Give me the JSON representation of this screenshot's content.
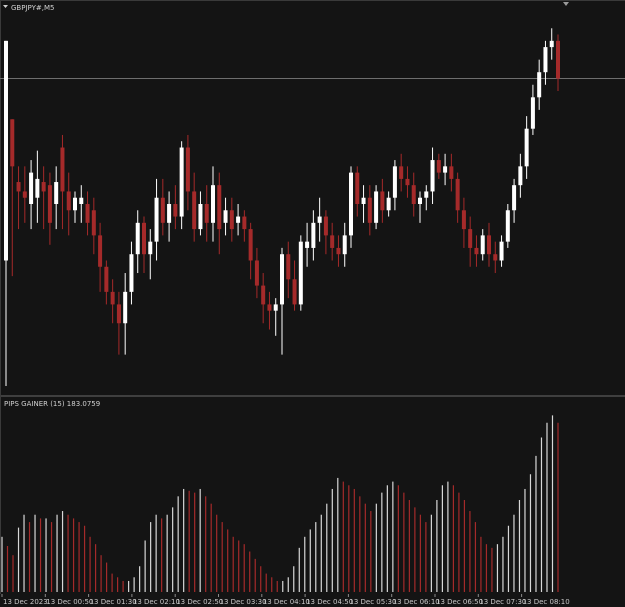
{
  "chart": {
    "symbol_label": "GBPJPY#,M5",
    "indicator_label": "PIPS GAINER (15) 183.0759",
    "colors": {
      "background": "#141414",
      "bull": "#ffffff",
      "bear": "#a52a2a",
      "grid_line": "#5a5a5a",
      "text": "#c8c8c8"
    }
  },
  "chart_data": [
    {
      "type": "candlestick",
      "title": "GBPJPY#,M5",
      "candles": [
        {
          "o": 184.2,
          "h": 183.9,
          "c": 183.5,
          "l": 183.1,
          "dir": "bull"
        },
        {
          "o": 183.95,
          "h": 183.9,
          "c": 183.8,
          "l": 183.45,
          "dir": "bear"
        },
        {
          "o": 183.72,
          "h": 183.8,
          "c": 183.75,
          "l": 183.6,
          "dir": "bear"
        },
        {
          "o": 183.7,
          "h": 183.8,
          "c": 183.72,
          "l": 183.62,
          "dir": "bear"
        },
        {
          "o": 183.68,
          "h": 183.82,
          "c": 183.78,
          "l": 183.6,
          "dir": "bull"
        },
        {
          "o": 183.76,
          "h": 183.85,
          "c": 183.7,
          "l": 183.62,
          "dir": "bull"
        },
        {
          "o": 183.72,
          "h": 183.8,
          "c": 183.75,
          "l": 183.6,
          "dir": "bear"
        },
        {
          "o": 183.74,
          "h": 183.78,
          "c": 183.62,
          "l": 183.55,
          "dir": "bear"
        },
        {
          "o": 183.68,
          "h": 183.8,
          "c": 183.75,
          "l": 183.6,
          "dir": "bull"
        },
        {
          "o": 183.86,
          "h": 183.9,
          "c": 183.72,
          "l": 183.6,
          "dir": "bear"
        },
        {
          "o": 183.72,
          "h": 183.78,
          "c": 183.66,
          "l": 183.58,
          "dir": "bear"
        },
        {
          "o": 183.66,
          "h": 183.72,
          "c": 183.7,
          "l": 183.62,
          "dir": "bull"
        },
        {
          "o": 183.7,
          "h": 183.74,
          "c": 183.68,
          "l": 183.62,
          "dir": "bull"
        },
        {
          "o": 183.68,
          "h": 183.72,
          "c": 183.62,
          "l": 183.58,
          "dir": "bear"
        },
        {
          "o": 183.66,
          "h": 183.7,
          "c": 183.58,
          "l": 183.52,
          "dir": "bear"
        },
        {
          "o": 183.58,
          "h": 183.62,
          "c": 183.48,
          "l": 183.4,
          "dir": "bear"
        },
        {
          "o": 183.48,
          "h": 183.5,
          "c": 183.4,
          "l": 183.36,
          "dir": "bear"
        },
        {
          "o": 183.4,
          "h": 183.44,
          "c": 183.36,
          "l": 183.3,
          "dir": "bear"
        },
        {
          "o": 183.36,
          "h": 183.4,
          "c": 183.3,
          "l": 183.2,
          "dir": "bear"
        },
        {
          "o": 183.3,
          "h": 183.46,
          "c": 183.4,
          "l": 183.2,
          "dir": "bull"
        },
        {
          "o": 183.4,
          "h": 183.56,
          "c": 183.52,
          "l": 183.36,
          "dir": "bull"
        },
        {
          "o": 183.52,
          "h": 183.66,
          "c": 183.62,
          "l": 183.46,
          "dir": "bull"
        },
        {
          "o": 183.62,
          "h": 183.64,
          "c": 183.52,
          "l": 183.46,
          "dir": "bear"
        },
        {
          "o": 183.52,
          "h": 183.6,
          "c": 183.56,
          "l": 183.44,
          "dir": "bull"
        },
        {
          "o": 183.56,
          "h": 183.76,
          "c": 183.7,
          "l": 183.5,
          "dir": "bull"
        },
        {
          "o": 183.7,
          "h": 183.76,
          "c": 183.62,
          "l": 183.58,
          "dir": "bear"
        },
        {
          "o": 183.62,
          "h": 183.72,
          "c": 183.68,
          "l": 183.56,
          "dir": "bull"
        },
        {
          "o": 183.68,
          "h": 183.74,
          "c": 183.64,
          "l": 183.6,
          "dir": "bear"
        },
        {
          "o": 183.64,
          "h": 183.88,
          "c": 183.86,
          "l": 183.6,
          "dir": "bull"
        },
        {
          "o": 183.86,
          "h": 183.9,
          "c": 183.72,
          "l": 183.66,
          "dir": "bear"
        },
        {
          "o": 183.72,
          "h": 183.78,
          "c": 183.6,
          "l": 183.56,
          "dir": "bear"
        },
        {
          "o": 183.6,
          "h": 183.72,
          "c": 183.68,
          "l": 183.58,
          "dir": "bull"
        },
        {
          "o": 183.68,
          "h": 183.74,
          "c": 183.62,
          "l": 183.56,
          "dir": "bear"
        },
        {
          "o": 183.62,
          "h": 183.8,
          "c": 183.74,
          "l": 183.56,
          "dir": "bull"
        },
        {
          "o": 183.74,
          "h": 183.78,
          "c": 183.6,
          "l": 183.52,
          "dir": "bear"
        },
        {
          "o": 183.62,
          "h": 183.7,
          "c": 183.66,
          "l": 183.58,
          "dir": "bull"
        },
        {
          "o": 183.66,
          "h": 183.7,
          "c": 183.6,
          "l": 183.56,
          "dir": "bear"
        },
        {
          "o": 183.62,
          "h": 183.68,
          "c": 183.64,
          "l": 183.58,
          "dir": "bull"
        },
        {
          "o": 183.64,
          "h": 183.66,
          "c": 183.6,
          "l": 183.56,
          "dir": "bear"
        },
        {
          "o": 183.6,
          "h": 183.62,
          "c": 183.5,
          "l": 183.44,
          "dir": "bear"
        },
        {
          "o": 183.5,
          "h": 183.54,
          "c": 183.42,
          "l": 183.38,
          "dir": "bear"
        },
        {
          "o": 183.42,
          "h": 183.46,
          "c": 183.36,
          "l": 183.3,
          "dir": "bear"
        },
        {
          "o": 183.36,
          "h": 183.4,
          "c": 183.34,
          "l": 183.28,
          "dir": "bear"
        },
        {
          "o": 183.34,
          "h": 183.38,
          "c": 183.36,
          "l": 183.26,
          "dir": "bull"
        },
        {
          "o": 183.36,
          "h": 183.54,
          "c": 183.52,
          "l": 183.2,
          "dir": "bull"
        },
        {
          "o": 183.52,
          "h": 183.56,
          "c": 183.44,
          "l": 183.38,
          "dir": "bear"
        },
        {
          "o": 183.44,
          "h": 183.5,
          "c": 183.36,
          "l": 183.34,
          "dir": "bear"
        },
        {
          "o": 183.36,
          "h": 183.58,
          "c": 183.56,
          "l": 183.34,
          "dir": "bull"
        },
        {
          "o": 183.56,
          "h": 183.62,
          "c": 183.54,
          "l": 183.48,
          "dir": "bull"
        },
        {
          "o": 183.54,
          "h": 183.66,
          "c": 183.62,
          "l": 183.5,
          "dir": "bull"
        },
        {
          "o": 183.62,
          "h": 183.7,
          "c": 183.64,
          "l": 183.56,
          "dir": "bull"
        },
        {
          "o": 183.64,
          "h": 183.66,
          "c": 183.58,
          "l": 183.52,
          "dir": "bear"
        },
        {
          "o": 183.58,
          "h": 183.62,
          "c": 183.54,
          "l": 183.5,
          "dir": "bear"
        },
        {
          "o": 183.54,
          "h": 183.58,
          "c": 183.52,
          "l": 183.48,
          "dir": "bear"
        },
        {
          "o": 183.52,
          "h": 183.62,
          "c": 183.58,
          "l": 183.48,
          "dir": "bull"
        },
        {
          "o": 183.58,
          "h": 183.8,
          "c": 183.78,
          "l": 183.54,
          "dir": "bull"
        },
        {
          "o": 183.78,
          "h": 183.8,
          "c": 183.68,
          "l": 183.64,
          "dir": "bear"
        },
        {
          "o": 183.68,
          "h": 183.74,
          "c": 183.7,
          "l": 183.62,
          "dir": "bull"
        },
        {
          "o": 183.7,
          "h": 183.74,
          "c": 183.62,
          "l": 183.58,
          "dir": "bear"
        },
        {
          "o": 183.62,
          "h": 183.74,
          "c": 183.72,
          "l": 183.6,
          "dir": "bull"
        },
        {
          "o": 183.72,
          "h": 183.76,
          "c": 183.66,
          "l": 183.62,
          "dir": "bear"
        },
        {
          "o": 183.66,
          "h": 183.72,
          "c": 183.7,
          "l": 183.64,
          "dir": "bull"
        },
        {
          "o": 183.7,
          "h": 183.82,
          "c": 183.8,
          "l": 183.66,
          "dir": "bull"
        },
        {
          "o": 183.8,
          "h": 183.84,
          "c": 183.76,
          "l": 183.72,
          "dir": "bear"
        },
        {
          "o": 183.76,
          "h": 183.8,
          "c": 183.74,
          "l": 183.7,
          "dir": "bear"
        },
        {
          "o": 183.74,
          "h": 183.78,
          "c": 183.68,
          "l": 183.64,
          "dir": "bear"
        },
        {
          "o": 183.68,
          "h": 183.72,
          "c": 183.7,
          "l": 183.62,
          "dir": "bull"
        },
        {
          "o": 183.7,
          "h": 183.74,
          "c": 183.72,
          "l": 183.66,
          "dir": "bull"
        },
        {
          "o": 183.72,
          "h": 183.86,
          "c": 183.82,
          "l": 183.68,
          "dir": "bull"
        },
        {
          "o": 183.82,
          "h": 183.84,
          "c": 183.78,
          "l": 183.76,
          "dir": "bear"
        },
        {
          "o": 183.78,
          "h": 183.84,
          "c": 183.8,
          "l": 183.74,
          "dir": "bull"
        },
        {
          "o": 183.8,
          "h": 183.84,
          "c": 183.76,
          "l": 183.72,
          "dir": "bear"
        },
        {
          "o": 183.76,
          "h": 183.78,
          "c": 183.66,
          "l": 183.62,
          "dir": "bear"
        },
        {
          "o": 183.66,
          "h": 183.7,
          "c": 183.6,
          "l": 183.54,
          "dir": "bear"
        },
        {
          "o": 183.6,
          "h": 183.64,
          "c": 183.54,
          "l": 183.48,
          "dir": "bear"
        },
        {
          "o": 183.54,
          "h": 183.58,
          "c": 183.52,
          "l": 183.48,
          "dir": "bear"
        },
        {
          "o": 183.52,
          "h": 183.6,
          "c": 183.58,
          "l": 183.5,
          "dir": "bull"
        },
        {
          "o": 183.58,
          "h": 183.62,
          "c": 183.52,
          "l": 183.48,
          "dir": "bear"
        },
        {
          "o": 183.52,
          "h": 183.56,
          "c": 183.5,
          "l": 183.46,
          "dir": "bear"
        },
        {
          "o": 183.5,
          "h": 183.58,
          "c": 183.56,
          "l": 183.48,
          "dir": "bull"
        },
        {
          "o": 183.56,
          "h": 183.68,
          "c": 183.66,
          "l": 183.54,
          "dir": "bull"
        },
        {
          "o": 183.66,
          "h": 183.76,
          "c": 183.74,
          "l": 183.62,
          "dir": "bull"
        },
        {
          "o": 183.74,
          "h": 183.84,
          "c": 183.8,
          "l": 183.7,
          "dir": "bull"
        },
        {
          "o": 183.8,
          "h": 183.96,
          "c": 183.92,
          "l": 183.76,
          "dir": "bull"
        },
        {
          "o": 183.92,
          "h": 184.06,
          "c": 184.02,
          "l": 183.9,
          "dir": "bull"
        },
        {
          "o": 184.02,
          "h": 184.14,
          "c": 184.1,
          "l": 183.98,
          "dir": "bull"
        },
        {
          "o": 184.1,
          "h": 184.2,
          "c": 184.18,
          "l": 184.06,
          "dir": "bull"
        },
        {
          "o": 184.18,
          "h": 184.24,
          "c": 184.2,
          "l": 184.14,
          "dir": "bull"
        },
        {
          "o": 184.2,
          "h": 184.22,
          "c": 184.08,
          "l": 184.04,
          "dir": "bear"
        }
      ],
      "y_range": [
        183.1,
        184.26
      ],
      "price_line": 184.08
    },
    {
      "type": "bar",
      "title": "PIPS GAINER (15) 183.0759",
      "values": [
        0.3,
        0.25,
        0.2,
        0.35,
        0.42,
        0.38,
        0.42,
        0.4,
        0.4,
        0.38,
        0.42,
        0.44,
        0.42,
        0.4,
        0.38,
        0.36,
        0.3,
        0.26,
        0.2,
        0.16,
        0.1,
        0.08,
        0.06,
        0.06,
        0.08,
        0.14,
        0.28,
        0.38,
        0.42,
        0.4,
        0.42,
        0.46,
        0.52,
        0.56,
        0.55,
        0.54,
        0.56,
        0.52,
        0.48,
        0.42,
        0.38,
        0.34,
        0.3,
        0.28,
        0.26,
        0.22,
        0.18,
        0.14,
        0.1,
        0.08,
        0.06,
        0.06,
        0.08,
        0.14,
        0.24,
        0.3,
        0.34,
        0.38,
        0.42,
        0.48,
        0.56,
        0.62,
        0.6,
        0.58,
        0.56,
        0.52,
        0.48,
        0.44,
        0.48,
        0.54,
        0.58,
        0.6,
        0.58,
        0.54,
        0.5,
        0.46,
        0.42,
        0.38,
        0.42,
        0.5,
        0.58,
        0.6,
        0.58,
        0.54,
        0.5,
        0.44,
        0.38,
        0.3,
        0.26,
        0.24,
        0.26,
        0.3,
        0.36,
        0.42,
        0.5,
        0.56,
        0.64,
        0.74,
        0.84,
        0.92,
        0.96,
        0.92
      ],
      "colors_per_bar": "bar color follows direction of candle: white rising, red falling"
    }
  ],
  "time_axis": {
    "labels": [
      "13 Dec 2023",
      "13 Dec 00:50",
      "13 Dec 01:30",
      "13 Dec 02:10",
      "13 Dec 02:50",
      "13 Dec 03:30",
      "13 Dec 04:10",
      "13 Dec 04:50",
      "13 Dec 05:30",
      "13 Dec 06:10",
      "13 Dec 06:50",
      "13 Dec 07:30",
      "13 Dec 08:10"
    ]
  }
}
